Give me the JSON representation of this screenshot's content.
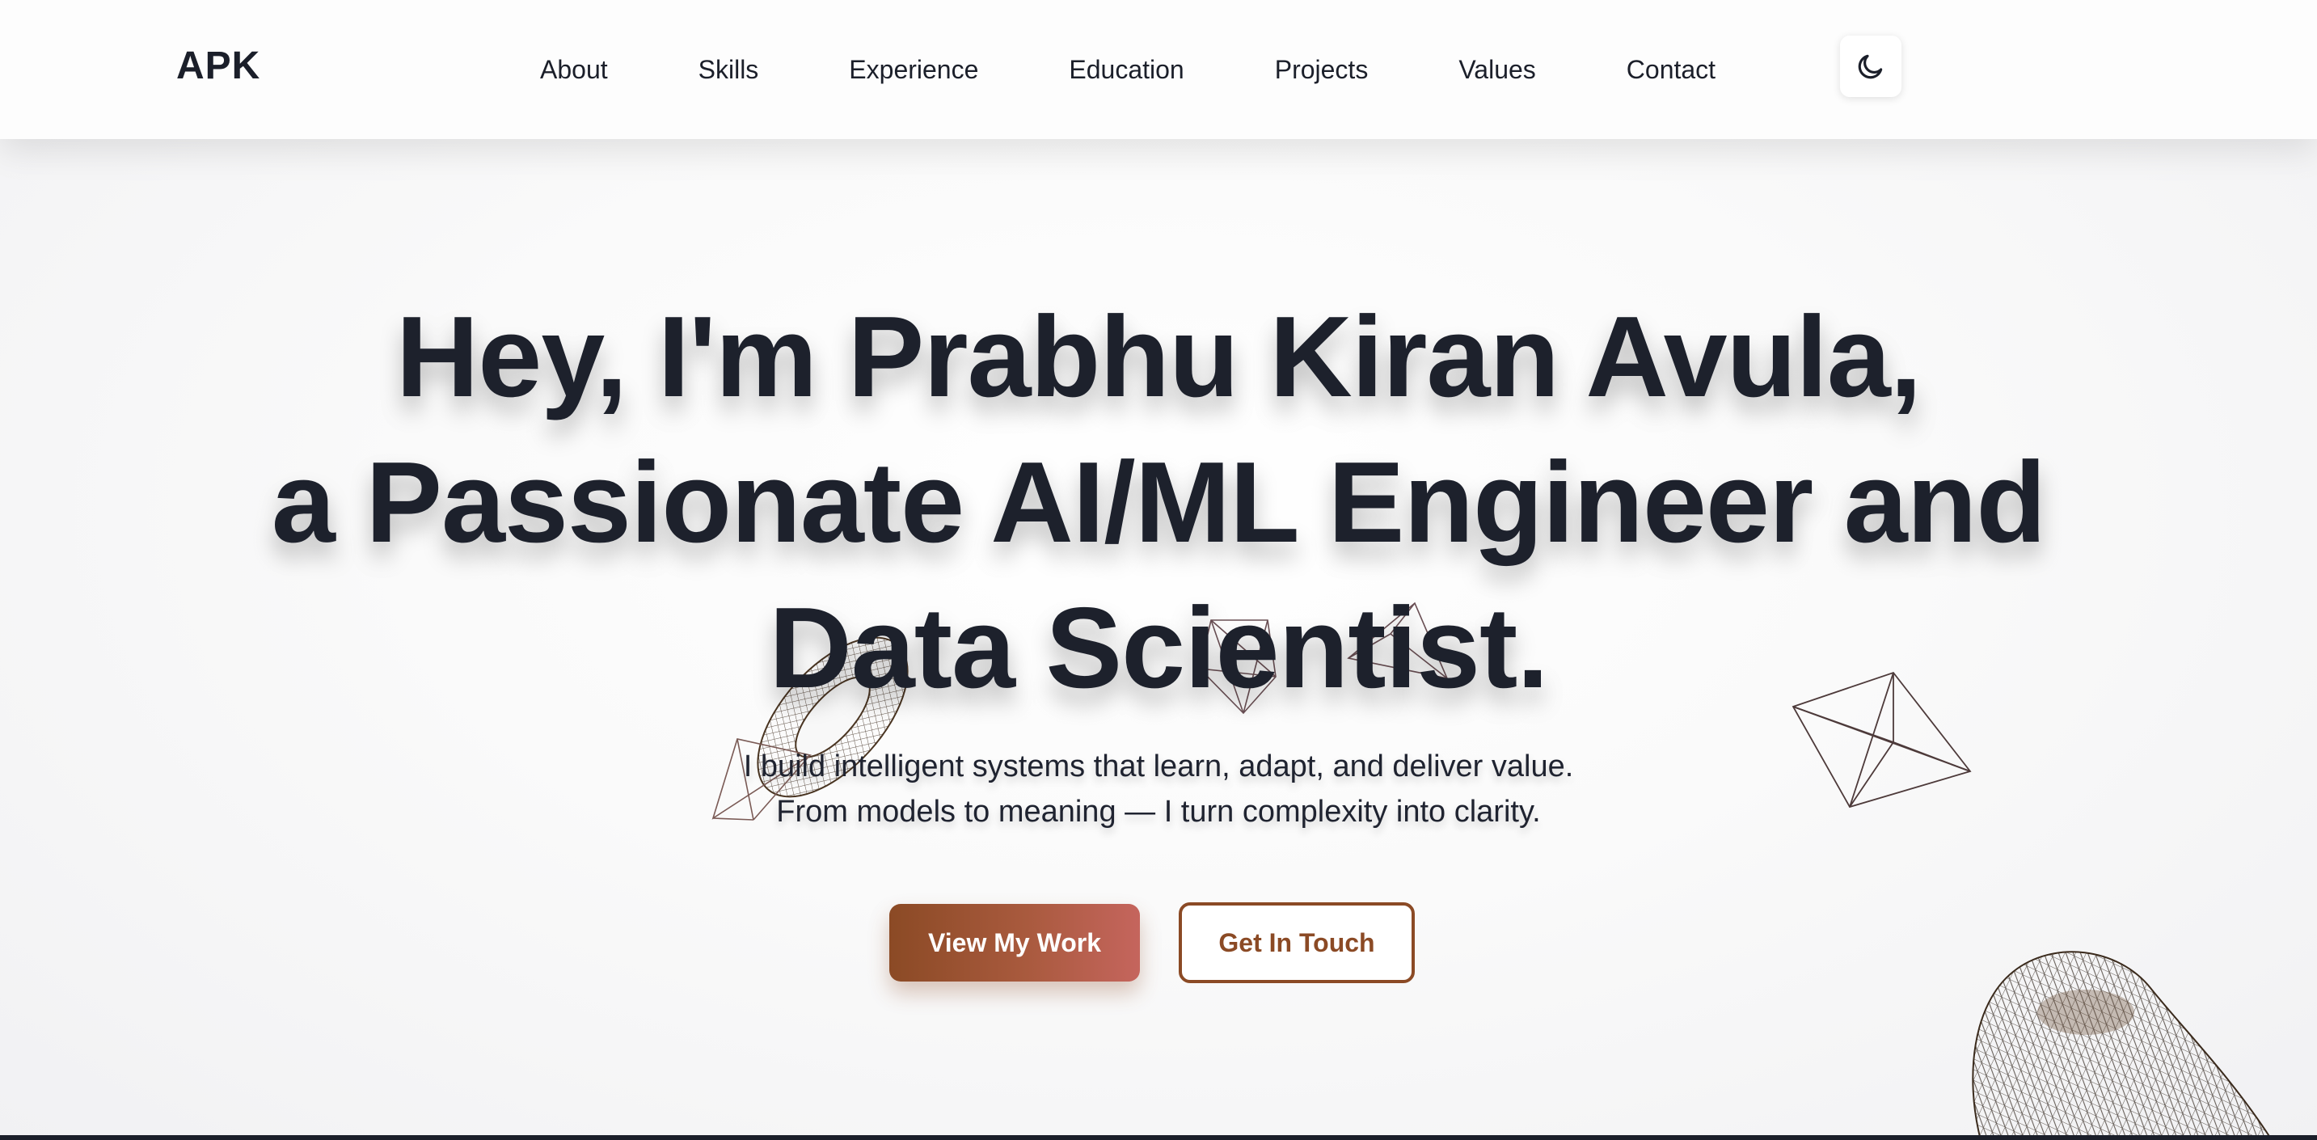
{
  "brand": {
    "logo": "APK"
  },
  "nav": {
    "items": [
      {
        "label": "About"
      },
      {
        "label": "Skills"
      },
      {
        "label": "Experience"
      },
      {
        "label": "Education"
      },
      {
        "label": "Projects"
      },
      {
        "label": "Values"
      },
      {
        "label": "Contact"
      }
    ],
    "theme_toggle_icon": "moon-icon"
  },
  "hero": {
    "title_lines": [
      "Hey, I'm Prabhu Kiran Avula,",
      "a Passionate AI/ML Engineer and",
      "Data Scientist."
    ],
    "subtitle_lines": [
      "I build intelligent systems that learn, adapt, and deliver value.",
      "From models to meaning — I turn complexity into clarity."
    ],
    "primary_button": "View My Work",
    "secondary_button": "Get In Touch"
  },
  "colors": {
    "text": "#1b1f2a",
    "accent": "#8b4a25",
    "accent_gradient_end": "#c5655d",
    "background": "#f6f6f7"
  },
  "decorations": [
    "wireframe-torus-icon",
    "wireframe-octahedron-icon",
    "wireframe-pyramid-icon",
    "wireframe-crystal-icon",
    "wireframe-pebble-icon"
  ]
}
